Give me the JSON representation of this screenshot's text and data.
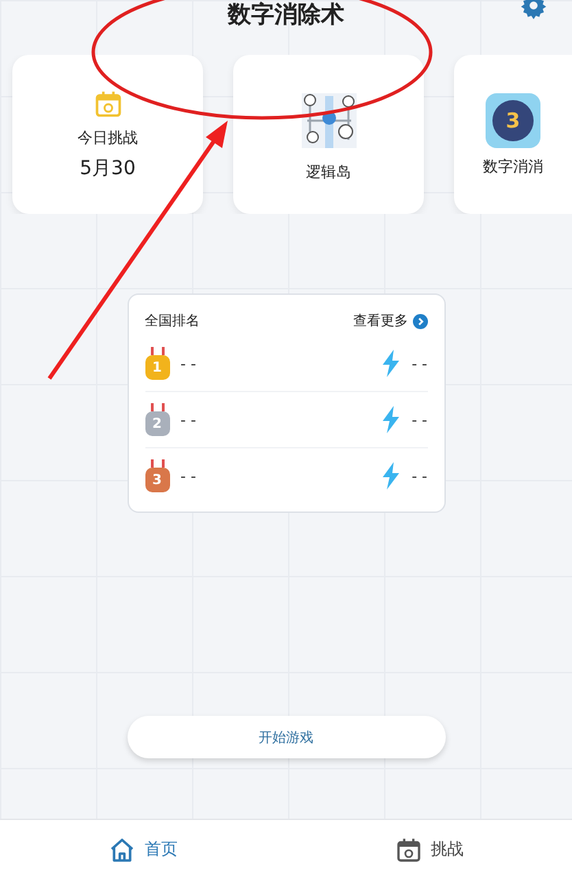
{
  "header": {
    "title": "数字消除术"
  },
  "mode_cards": [
    {
      "kind": "daily",
      "title": "今日挑战",
      "date": "5月30"
    },
    {
      "kind": "logic",
      "title": "逻辑岛"
    },
    {
      "kind": "bomb",
      "title": "数字消消",
      "badge": "3"
    }
  ],
  "ranking": {
    "title": "全国排名",
    "more_link": "查看更多",
    "rows": [
      {
        "rank": "1",
        "name": "- -",
        "score": "- -",
        "color": "#f2b31c"
      },
      {
        "rank": "2",
        "name": "- -",
        "score": "- -",
        "color": "#a9b0bb"
      },
      {
        "rank": "3",
        "name": "- -",
        "score": "- -",
        "color": "#d9774a"
      }
    ]
  },
  "start_button": "开始游戏",
  "tabs": [
    {
      "label": "首页",
      "selected": true,
      "kind": "home"
    },
    {
      "label": "挑战",
      "selected": false,
      "kind": "calendar"
    }
  ],
  "annotations": {
    "ellipse": true,
    "arrow": true
  }
}
